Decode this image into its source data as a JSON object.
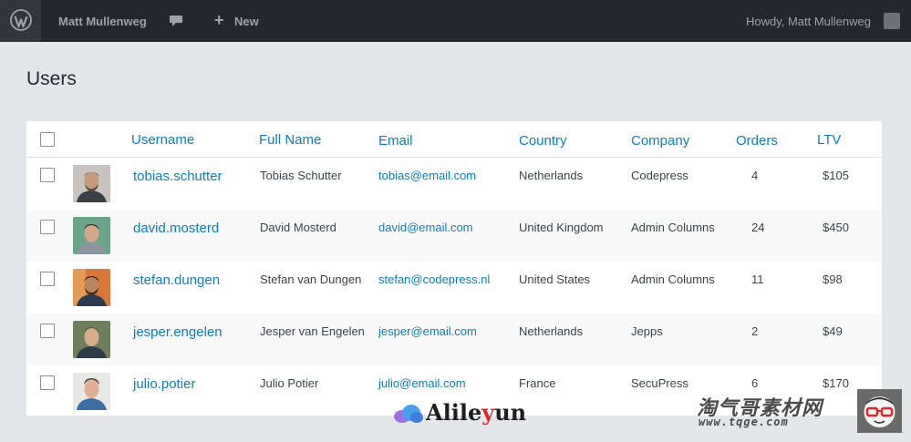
{
  "adminbar": {
    "user_name": "Matt Mullenweg",
    "new_label": "New",
    "howdy": "Howdy,  Matt Mullenweg",
    "icons": [
      "wordpress-logo-icon",
      "comment-icon",
      "plus-icon",
      "user-avatar"
    ]
  },
  "page": {
    "title": "Users"
  },
  "table": {
    "columns": {
      "username": "Username",
      "full_name": "Full Name",
      "email": "Email",
      "country": "Country",
      "company": "Company",
      "orders": "Orders",
      "ltv": "LTV"
    },
    "rows": [
      {
        "username": "tobias.schutter",
        "full_name": "Tobias Schutter",
        "email": "tobias@email.com",
        "country": "Netherlands",
        "company": "Codepress",
        "orders": "4",
        "ltv": "$105"
      },
      {
        "username": "david.mosterd",
        "full_name": "David Mosterd",
        "email": "david@email.com",
        "country": "United Kingdom",
        "company": "Admin Columns",
        "orders": "24",
        "ltv": "$450"
      },
      {
        "username": "stefan.dungen",
        "full_name": "Stefan van Dungen",
        "email": "stefan@codepress.nl",
        "country": "United States",
        "company": "Admin Columns",
        "orders": "11",
        "ltv": "$98"
      },
      {
        "username": "jesper.engelen",
        "full_name": "Jesper van Engelen",
        "email": "jesper@email.com",
        "country": "Netherlands",
        "company": "Jepps",
        "orders": "2",
        "ltv": "$49"
      },
      {
        "username": "julio.potier",
        "full_name": "Julio Potier",
        "email": "julio@email.com",
        "country": "France",
        "company": "SecuPress",
        "orders": "6",
        "ltv": "$170"
      }
    ]
  },
  "watermarks": {
    "alileyun_pre": "Alile",
    "alileyun_y": "y",
    "alileyun_post": "un",
    "tqge_title": "淘气哥素材网",
    "tqge_url": "www.tqge.com"
  },
  "colors": {
    "adminbar_bg": "#24282d",
    "link": "#0c7fbf",
    "page_bg": "#e4e6ea"
  }
}
